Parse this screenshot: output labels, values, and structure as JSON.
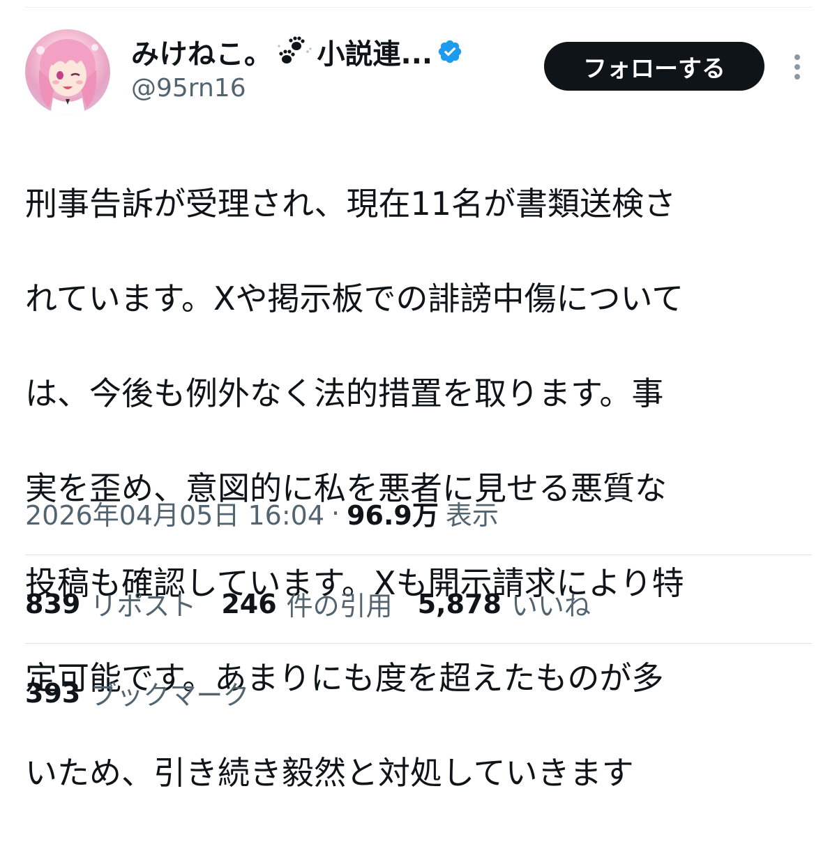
{
  "author": {
    "display_name": "みけねこ。",
    "display_name_rest": "小説連...",
    "handle": "@95rn16",
    "verified": true,
    "avatar_icon": "anime-girl-avatar",
    "name_emoji_icon": "paw-prints-icon"
  },
  "actions": {
    "follow_label": "フォローする",
    "more_icon": "more-vertical-icon"
  },
  "tweet": {
    "lines": [
      "刑事告訴が受理され、現在11名が書類送検さ",
      "れています。Xや掲示板での誹謗中傷について",
      "は、今後も例外なく法的措置を取ります。事",
      "実を歪め、意図的に私を悪者に見せる悪質な",
      "投稿も確認しています。Xも開示請求により特",
      "定可能です。あまりにも度を超えたものが多",
      "いため、引き続き毅然と対処していきます"
    ]
  },
  "meta": {
    "timestamp": "2026年04月05日 16:04",
    "separator": "·",
    "views_count": "96.9万",
    "views_label": "表示"
  },
  "stats": {
    "reposts_count": "839",
    "reposts_label": "リポスト",
    "quotes_count": "246",
    "quotes_label": "件の引用",
    "likes_count": "5,878",
    "likes_label": "いいね",
    "bookmarks_count": "393",
    "bookmarks_label": "ブックマーク"
  },
  "colors": {
    "text_primary": "#0f1419",
    "text_secondary": "#536471",
    "verified_blue": "#1d9bf0",
    "follow_bg": "#0f1419",
    "divider": "#dfe3e6"
  }
}
